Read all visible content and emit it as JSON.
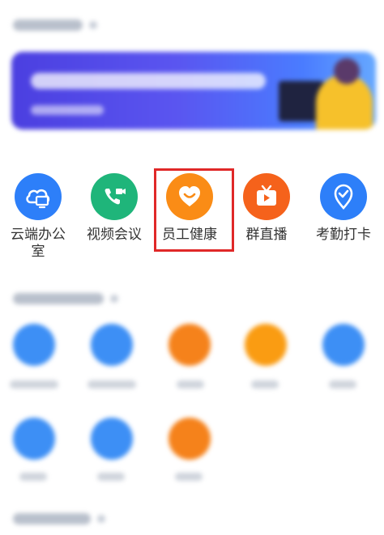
{
  "apps": [
    {
      "id": "cloud-office",
      "label": "云端办公室",
      "icon": "cloud-computer-icon",
      "color": "#2d7ff9"
    },
    {
      "id": "video-meeting",
      "label": "视频会议",
      "icon": "video-call-icon",
      "color": "#1fb57a"
    },
    {
      "id": "employee-health",
      "label": "员工健康",
      "icon": "heart-smile-icon",
      "color": "#fa8c16"
    },
    {
      "id": "group-live",
      "label": "群直播",
      "icon": "tv-play-icon",
      "color": "#f5621b"
    },
    {
      "id": "attendance",
      "label": "考勤打卡",
      "icon": "location-check-icon",
      "color": "#2d7ff9"
    }
  ],
  "highlight": {
    "target": "employee-health",
    "color": "#e02828"
  }
}
